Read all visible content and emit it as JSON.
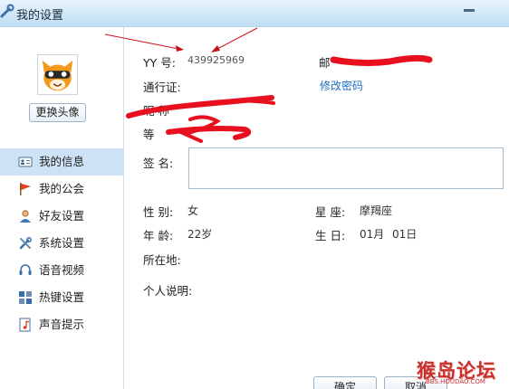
{
  "window": {
    "title": "我的设置"
  },
  "sidebar": {
    "change_avatar_label": "更换头像",
    "items": [
      {
        "label": "我的信息",
        "icon": "id-card-icon",
        "active": true
      },
      {
        "label": "我的公会",
        "icon": "flag-icon",
        "active": false
      },
      {
        "label": "好友设置",
        "icon": "user-icon",
        "active": false
      },
      {
        "label": "系统设置",
        "icon": "tools-icon",
        "active": false
      },
      {
        "label": "语音视频",
        "icon": "headset-icon",
        "active": false
      },
      {
        "label": "热键设置",
        "icon": "hotkey-icon",
        "active": false
      },
      {
        "label": "声音提示",
        "icon": "sound-note-icon",
        "active": false
      }
    ]
  },
  "profile": {
    "yy_label": "YY 号:",
    "yy_value": "439925969",
    "email_label": "邮",
    "passport_label": "通行证:",
    "change_password_link": "修改密码",
    "nickname_label": "昵 称",
    "level_label": "等",
    "signature_label": "签 名:",
    "signature_value": "",
    "gender_label": "性 别:",
    "gender_value": "女",
    "zodiac_label": "星 座:",
    "zodiac_value": "摩羯座",
    "age_label": "年 龄:",
    "age_value": "22岁",
    "birthday_label": "生 日:",
    "birthday_month": "01月",
    "birthday_day": "01日",
    "location_label": "所在地:",
    "bio_label": "个人说明:"
  },
  "footer": {
    "ok_label": "确定",
    "cancel_label": "取消"
  },
  "watermark": {
    "main": "猴岛论坛",
    "sub": "BBS.HOUDAO.COM"
  },
  "colors": {
    "accent": "#1b6ec2",
    "active_nav": "#cde3f5",
    "scribble": "#e8101e",
    "watermark": "#c9302c"
  }
}
